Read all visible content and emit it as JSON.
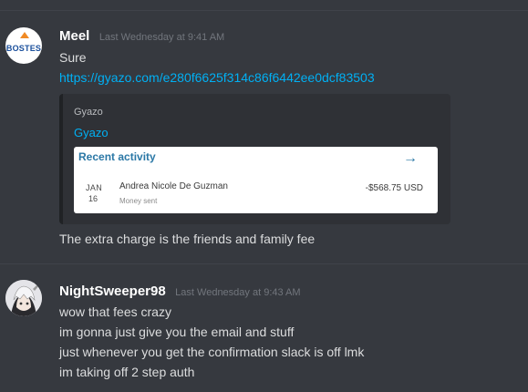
{
  "messages": [
    {
      "author": "Meel",
      "avatar_icon": "bostes-logo-icon",
      "timestamp": "Last Wednesday at 9:41 AM",
      "lines": [
        "Sure"
      ],
      "link": "https://gyazo.com/e280f6625f314c86f6442ee0dcf83503",
      "embed": {
        "provider": "Gyazo",
        "title": "Gyazo",
        "card": {
          "heading": "Recent activity",
          "arrow_icon": "arrow-right-icon",
          "month": "JAN",
          "day": "16",
          "name": "Andrea Nicole De Guzman",
          "subtitle": "Money sent",
          "amount": "-$568.75 USD"
        }
      },
      "followup": "The extra charge is the friends and family fee"
    },
    {
      "author": "NightSweeper98",
      "avatar_icon": "anime-avatar-icon",
      "timestamp": "Last Wednesday at 9:43 AM",
      "lines": [
        "wow that fees crazy",
        "im gonna just give you the email and stuff",
        "just whenever you get the confirmation slack is off lmk",
        "im taking off 2 step auth"
      ]
    }
  ],
  "colors": {
    "background": "#36393f",
    "link": "#00b0f4",
    "username": "#ffffff",
    "text": "#dcddde",
    "timestamp": "#72767d"
  }
}
